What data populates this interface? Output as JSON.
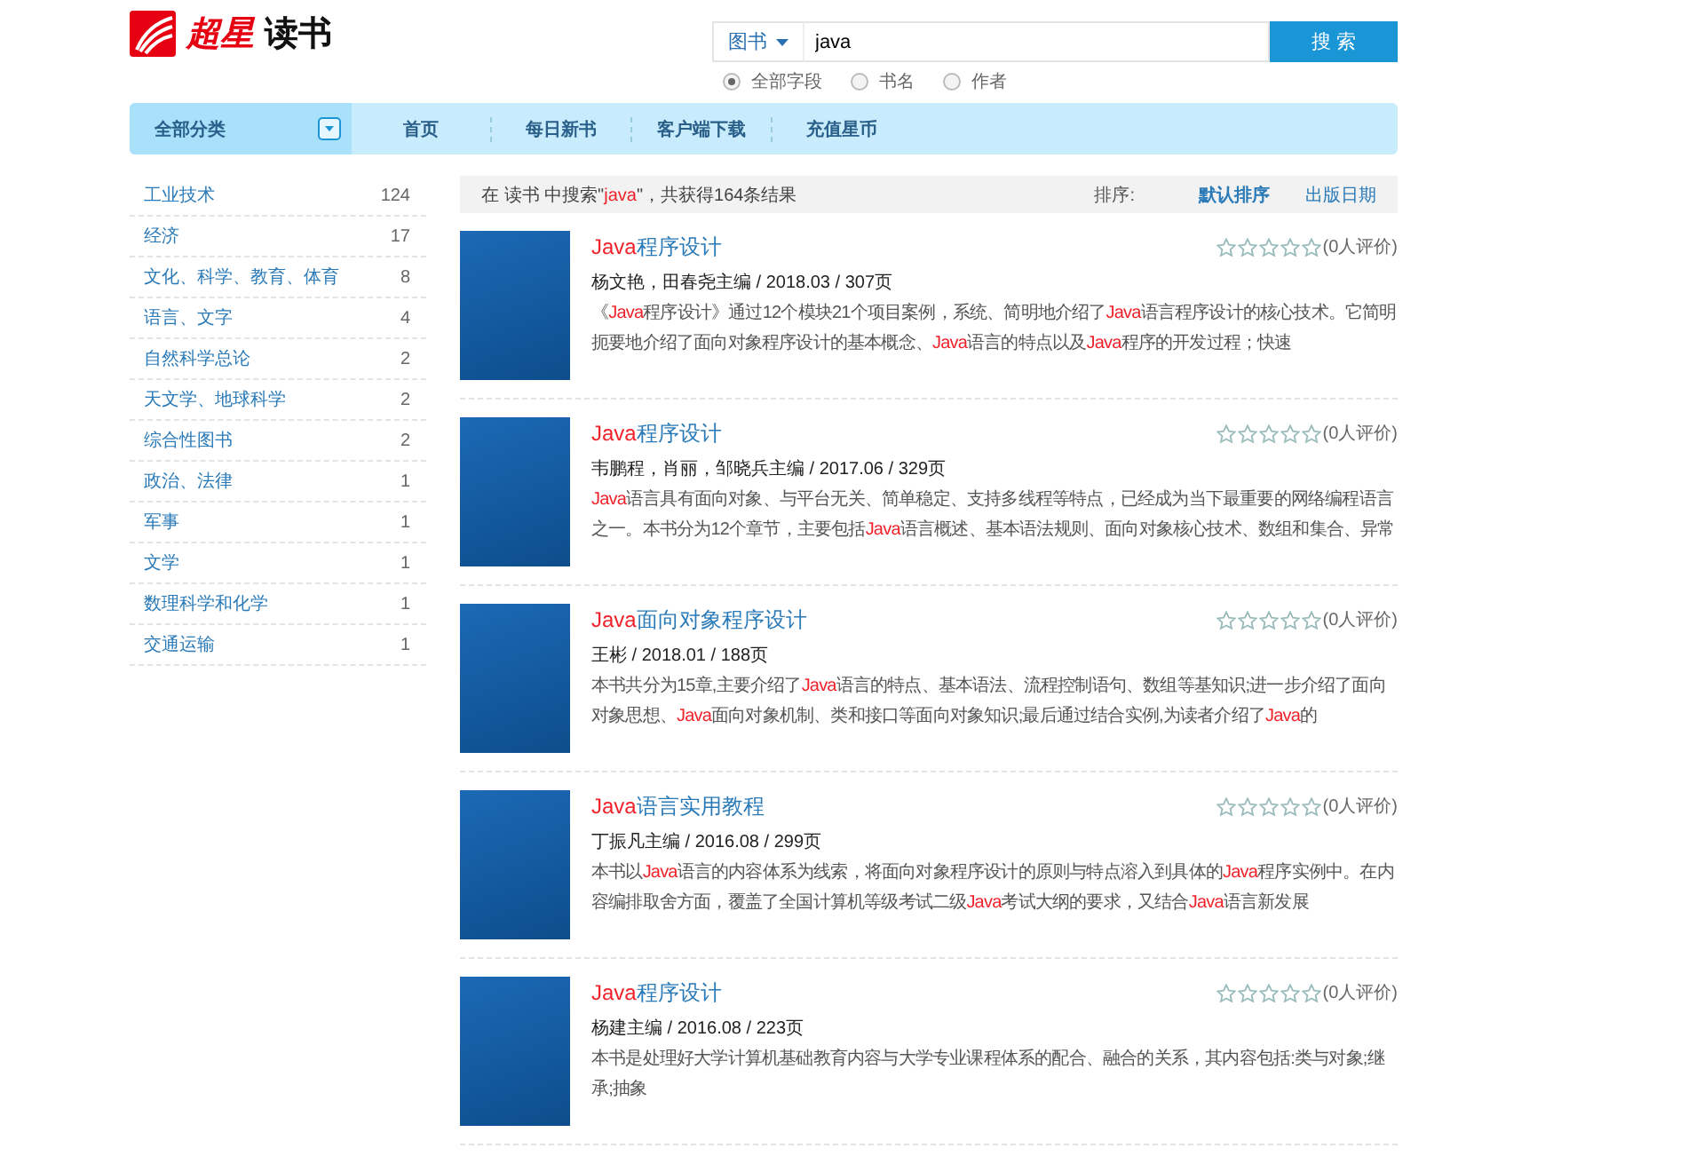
{
  "logo": {
    "brand": "超星",
    "product": "读书"
  },
  "search": {
    "scope": "图书",
    "value": "java",
    "button": "搜 索",
    "options": [
      {
        "label": "全部字段",
        "selected": true
      },
      {
        "label": "书名",
        "selected": false
      },
      {
        "label": "作者",
        "selected": false
      }
    ]
  },
  "nav": {
    "category": "全部分类",
    "items": [
      "首页",
      "每日新书",
      "客户端下载",
      "充值星币"
    ]
  },
  "sidebar": {
    "items": [
      {
        "label": "工业技术",
        "count": "124"
      },
      {
        "label": "经济",
        "count": "17"
      },
      {
        "label": "文化、科学、教育、体育",
        "count": "8"
      },
      {
        "label": "语言、文字",
        "count": "4"
      },
      {
        "label": "自然科学总论",
        "count": "2"
      },
      {
        "label": "天文学、地球科学",
        "count": "2"
      },
      {
        "label": "综合性图书",
        "count": "2"
      },
      {
        "label": "政治、法律",
        "count": "1"
      },
      {
        "label": "军事",
        "count": "1"
      },
      {
        "label": "文学",
        "count": "1"
      },
      {
        "label": "数理科学和化学",
        "count": "1"
      },
      {
        "label": "交通运输",
        "count": "1"
      }
    ]
  },
  "results_bar": {
    "summary": [
      {
        "text": "在 读书 中搜索\"",
        "highlight": false
      },
      {
        "text": "java",
        "highlight": true
      },
      {
        "text": "\"，共获得164条结果",
        "highlight": false
      }
    ],
    "sort_label": "排序:",
    "sort_options": [
      {
        "label": "默认排序",
        "selected": true
      },
      {
        "label": "出版日期",
        "selected": false
      }
    ]
  },
  "books": [
    {
      "title": [
        {
          "text": "Java",
          "highlight": true
        },
        {
          "text": "程序设计",
          "highlight": false
        }
      ],
      "stars": 0,
      "rating": "(0人评价)",
      "meta": "杨文艳，田春尧主编 / 2018.03 / 307页",
      "description": [
        {
          "text": "《",
          "highlight": false
        },
        {
          "text": "Java",
          "highlight": true
        },
        {
          "text": "程序设计》通过12个模块21个项目案例，系统、简明地介绍了",
          "highlight": false
        },
        {
          "text": "Java",
          "highlight": true
        },
        {
          "text": "语言程序设计的核心技术。它简明扼要地介绍了面向对象程序设计的基本概念、",
          "highlight": false
        },
        {
          "text": "Java",
          "highlight": true
        },
        {
          "text": "语言的特点以及",
          "highlight": false
        },
        {
          "text": "Java",
          "highlight": true
        },
        {
          "text": "程序的开发过程；快速",
          "highlight": false
        }
      ]
    },
    {
      "title": [
        {
          "text": "Java",
          "highlight": true
        },
        {
          "text": "程序设计",
          "highlight": false
        }
      ],
      "stars": 0,
      "rating": "(0人评价)",
      "meta": "韦鹏程，肖丽，邹晓兵主编 / 2017.06 / 329页",
      "description": [
        {
          "text": "Java",
          "highlight": true
        },
        {
          "text": "语言具有面向对象、与平台无关、简单稳定、支持多线程等特点，已经成为当下最重要的网络编程语言之一。本书分为12个章节，主要包括",
          "highlight": false
        },
        {
          "text": "Java",
          "highlight": true
        },
        {
          "text": "语言概述、基本语法规则、面向对象核心技术、数组和集合、异常",
          "highlight": false
        }
      ]
    },
    {
      "title": [
        {
          "text": "Java",
          "highlight": true
        },
        {
          "text": "面向对象程序设计",
          "highlight": false
        }
      ],
      "stars": 0,
      "rating": "(0人评价)",
      "meta": "王彬 / 2018.01 / 188页",
      "description": [
        {
          "text": "本书共分为15章,主要介绍了",
          "highlight": false
        },
        {
          "text": "Java",
          "highlight": true
        },
        {
          "text": "语言的特点、基本语法、流程控制语句、数组等基知识;进一步介绍了面向对象思想、",
          "highlight": false
        },
        {
          "text": "Java",
          "highlight": true
        },
        {
          "text": "面向对象机制、类和接口等面向对象知识;最后通过结合实例,为读者介绍了",
          "highlight": false
        },
        {
          "text": "Java",
          "highlight": true
        },
        {
          "text": "的",
          "highlight": false
        }
      ]
    },
    {
      "title": [
        {
          "text": "Java",
          "highlight": true
        },
        {
          "text": "语言实用教程",
          "highlight": false
        }
      ],
      "stars": 0,
      "rating": "(0人评价)",
      "meta": "丁振凡主编 / 2016.08 / 299页",
      "description": [
        {
          "text": "本书以",
          "highlight": false
        },
        {
          "text": "Java",
          "highlight": true
        },
        {
          "text": "语言的内容体系为线索，将面向对象程序设计的原则与特点溶入到具体的",
          "highlight": false
        },
        {
          "text": "Java",
          "highlight": true
        },
        {
          "text": "程序实例中。在内容编排取舍方面，覆盖了全国计算机等级考试二级",
          "highlight": false
        },
        {
          "text": "Java",
          "highlight": true
        },
        {
          "text": "考试大纲的要求，又结合",
          "highlight": false
        },
        {
          "text": "Java",
          "highlight": true
        },
        {
          "text": "语言新发展",
          "highlight": false
        }
      ]
    },
    {
      "title": [
        {
          "text": "Java",
          "highlight": true
        },
        {
          "text": "程序设计",
          "highlight": false
        }
      ],
      "stars": 0,
      "rating": "(0人评价)",
      "meta": "杨建主编 / 2016.08 / 223页",
      "description": [
        {
          "text": "本书是处理好大学计算机基础教育内容与大学专业课程体系的配合、融合的关系，其内容包括:类与对象;继承;抽象",
          "highlight": false
        }
      ]
    }
  ]
}
